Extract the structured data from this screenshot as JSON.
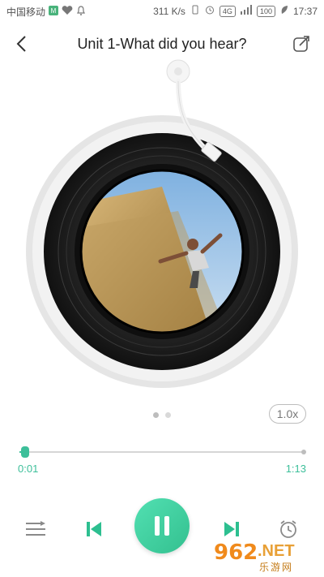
{
  "status_bar": {
    "carrier": "中国移动",
    "speed": "311 K/s",
    "battery": "100",
    "time": "17:37",
    "network": "4G"
  },
  "header": {
    "title": "Unit 1-What did you hear?",
    "back_icon": "chevron-left-icon",
    "share_icon": "share-icon"
  },
  "player": {
    "speed_label": "1.0x",
    "pager_count": 2,
    "pager_active_index": 0,
    "current_time": "0:01",
    "total_time": "1:13",
    "progress_fraction": 0.02
  },
  "controls": {
    "playlist_icon": "playlist-icon",
    "prev_icon": "skip-previous-icon",
    "play_icon": "pause-icon",
    "next_icon": "skip-next-icon",
    "timer_icon": "alarm-clock-icon"
  },
  "watermark": {
    "brand": "962",
    "suffix": ".NET",
    "sub": "乐游网"
  },
  "colors": {
    "accent": "#3dbf9a",
    "accent_light": "#52e0b2",
    "text_primary": "#222222",
    "muted": "#9e9e9e"
  }
}
